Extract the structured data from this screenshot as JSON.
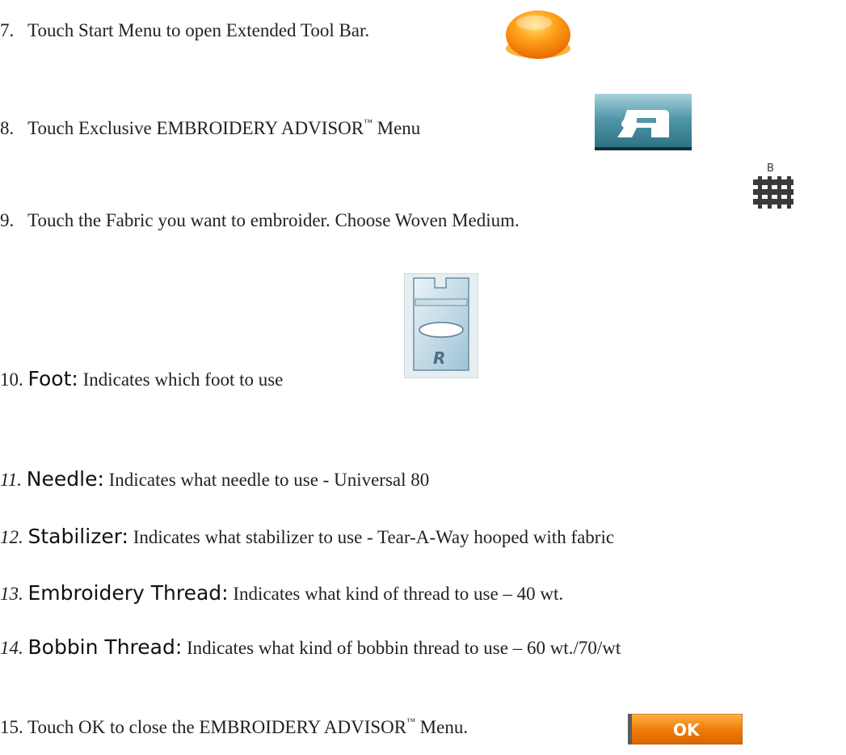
{
  "steps": [
    {
      "num": "7.",
      "text": "Touch Start Menu to open Extended Tool Bar.",
      "icon": "start-menu-orange-orb-icon"
    },
    {
      "num": "8.",
      "text_before": "Touch Exclusive EMBROIDERY ADVISOR",
      "tm": "™",
      "text_after": " Menu",
      "icon": "embroidery-advisor-sewing-machine-icon"
    },
    {
      "num": "9.",
      "text": "Touch the Fabric you want to embroider. Choose Woven Medium.",
      "icon": "woven-fabric-icon",
      "icon_label": "B"
    },
    {
      "num": "10.",
      "term": "Foot:",
      "text": " Indicates which foot to use",
      "icon": "presser-foot-r-icon",
      "icon_label": "R"
    },
    {
      "num": "11.",
      "term": "Needle:",
      "text": " Indicates what needle to use - Universal 80"
    },
    {
      "num": "12.",
      "term": "Stabilizer:",
      "text": " Indicates what stabilizer to use - Tear-A-Way hooped with fabric"
    },
    {
      "num": "13.",
      "term": "Embroidery Thread:",
      "text": " Indicates what kind of thread to use – 40 wt."
    },
    {
      "num": "14.",
      "term": "Bobbin Thread:",
      "text": " Indicates what kind of bobbin thread to use – 60 wt./70/wt"
    },
    {
      "num": "15.",
      "text_before": "Touch OK to close the EMBROIDERY ADVISOR",
      "tm": "™",
      "text_after": " Menu.",
      "icon": "ok-button",
      "icon_label": "OK"
    }
  ]
}
